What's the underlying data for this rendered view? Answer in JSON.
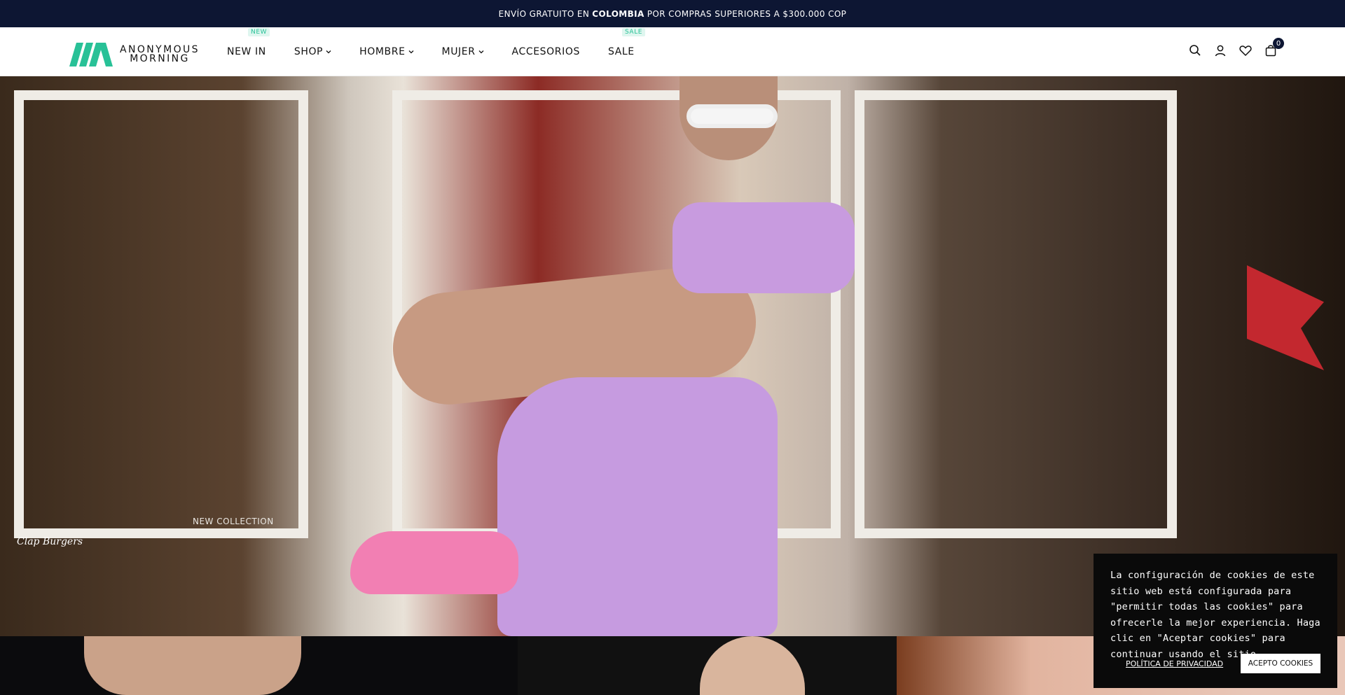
{
  "announcement": {
    "prefix": "ENVÍO GRATUITO EN",
    "country": "COLOMBIA",
    "suffix": "POR COMPRAS SUPERIORES A $300.000 COP"
  },
  "header": {
    "logo_line1": "ANONYMOUS",
    "logo_line2": "MORNING",
    "nav": [
      {
        "label": "NEW IN",
        "badge": "NEW",
        "has_dropdown": false
      },
      {
        "label": "SHOP",
        "has_dropdown": true
      },
      {
        "label": "HOMBRE",
        "has_dropdown": true
      },
      {
        "label": "MUJER",
        "has_dropdown": true
      },
      {
        "label": "ACCESORIOS",
        "has_dropdown": false
      },
      {
        "label": "SALE",
        "badge": "SALE",
        "has_dropdown": false
      }
    ],
    "cart_count": "0",
    "icons": [
      "search-icon",
      "user-icon",
      "heart-icon",
      "cart-icon"
    ]
  },
  "hero": {
    "overlay_text": "NEW COLLECTION",
    "sign_text": "Clap Burgers"
  },
  "cookie": {
    "message": "La configuración de cookies de este sitio web está configurada para \"permitir todas las cookies\" para ofrecerle la mejor experiencia. Haga clic en \"Aceptar cookies\" para continuar usando el sitio.",
    "policy_link": "POLÍTICA DE PRIVACIDAD",
    "accept_button": "ACEPTO COOKIES"
  },
  "colors": {
    "announcement_bg": "#0d1633",
    "brand_green": "#28c197",
    "cookie_bg": "#0a0a0a"
  }
}
